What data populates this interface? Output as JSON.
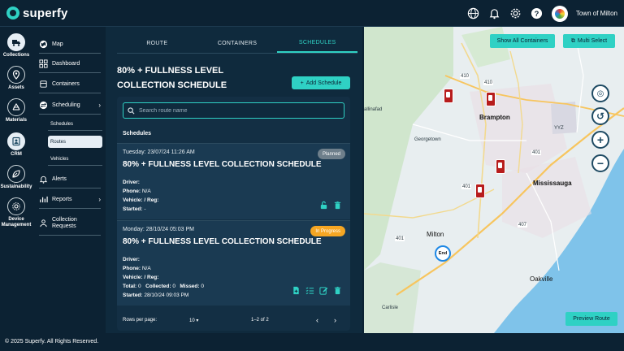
{
  "brand": {
    "name": "superfy"
  },
  "topbar": {
    "org": "Town of Milton"
  },
  "rail": [
    {
      "label": "Collections",
      "icon": "truck-icon",
      "active": true
    },
    {
      "label": "Assets",
      "icon": "pin-icon"
    },
    {
      "label": "Materials",
      "icon": "recycle-icon"
    },
    {
      "label": "CRM",
      "icon": "crm-icon"
    },
    {
      "label": "Sustainability",
      "icon": "leaf-icon"
    },
    {
      "label": "Device Management",
      "icon": "device-icon"
    }
  ],
  "nav": {
    "map": "Map",
    "dashboard": "Dashboard",
    "containers": "Containers",
    "scheduling": "Scheduling",
    "schedules": "Schedules",
    "routes": "Routes",
    "vehicles": "Vehicles",
    "alerts": "Alerts",
    "reports": "Reports",
    "collection_requests": "Collection Requests"
  },
  "tabs": {
    "route": "ROUTE",
    "containers": "CONTAINERS",
    "schedules": "SCHEDULES"
  },
  "panel": {
    "title": "80% + FULLNESS LEVEL COLLECTION SCHEDULE",
    "add_button": "Add Schedule",
    "search_placeholder": "Search route name",
    "schedules_label": "Schedules"
  },
  "cards": [
    {
      "date": "Tuesday: 23/07/24 11:26 AM",
      "name": "80% + FULLNESS LEVEL COLLECTION SCHEDULE",
      "status": "Planned",
      "driver_label": "Driver:",
      "phone_label": "Phone:",
      "phone": "N/A",
      "vehicle_label": "Vehicle:",
      "vehicle": "/ Reg:",
      "started_label": "Started:",
      "started": "-"
    },
    {
      "date": "Monday: 28/10/24 05:03 PM",
      "name": "80% + FULLNESS LEVEL COLLECTION SCHEDULE",
      "status": "In Progress",
      "driver_label": "Driver:",
      "phone_label": "Phone:",
      "phone": "N/A",
      "vehicle_label": "Vehicle:",
      "vehicle": "/ Reg:",
      "total_label": "Total:",
      "total": "0",
      "collected_label": "Collected:",
      "collected": "0",
      "missed_label": "Missed:",
      "missed": "0",
      "started_label": "Started:",
      "started": "28/10/24 09:03 PM"
    }
  ],
  "pager": {
    "rows_label": "Rows per page:",
    "rows_value": "10",
    "range": "1–2 of 2"
  },
  "map": {
    "show_all": "Show All Containers",
    "multi_select": "Multi Select",
    "preview_route": "Preview Route",
    "end_marker": "End",
    "labels": {
      "brampton": "Brampton",
      "mississauga": "Mississauga",
      "milton": "Milton",
      "georgetown": "Georgetown",
      "oakville": "Oakville",
      "carlisle": "Carlisle",
      "ballinafad": "allinafad",
      "yyz": "YYZ",
      "h410a": "410",
      "h410b": "410",
      "h401a": "401",
      "h401b": "401",
      "h401c": "401",
      "h407": "407"
    }
  },
  "footer": {
    "copyright": "© 2025 Superfy. All Rights Reserved."
  }
}
